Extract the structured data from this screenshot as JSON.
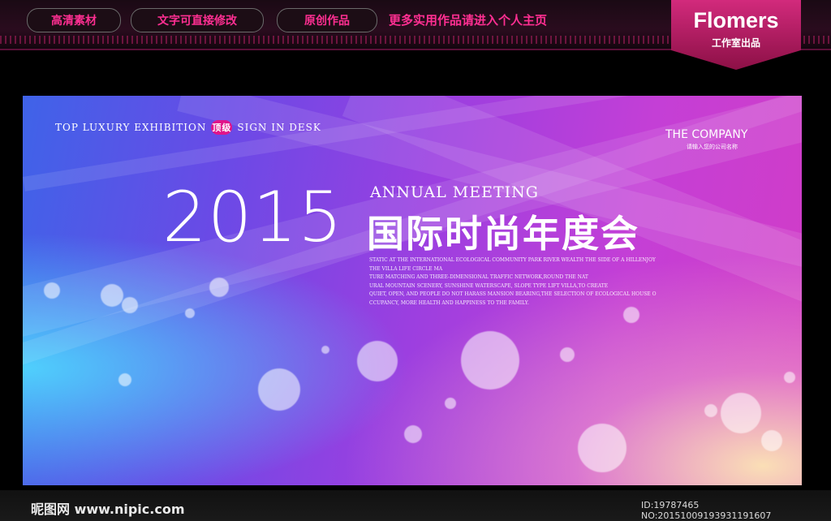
{
  "topbar": {
    "pills": [
      "高清素材",
      "文字可直接修改",
      "原创作品"
    ],
    "more": "更多实用作品请进入个人主页",
    "brand_name": "Flomers",
    "brand_sub": "工作室出品"
  },
  "poster": {
    "tagline_left": "TOP LUXURY EXHIBITION",
    "tagline_badge": "顶级",
    "tagline_right": "SIGN IN DESK",
    "company": "THE COMPANY",
    "company_sub": "请输入您的公司名称",
    "year": "2015",
    "annual": "ANNUAL MEETING",
    "title_cn": "国际时尚年度会",
    "desc_lines": [
      "STATIC AT THE INTERNATIONAL ECOLOGICAL COMMUNITY PARK RIVER WEALTH THE SIDE OF A HILLENJOY",
      "THE VILLA LIFE CIRCLE MA",
      "TURE MATCHING AND THREE-DIMENSIONAL TRAFFIC NETWORK,ROUND THE NAT",
      "URAL MOUNTAIN SCENERY, SUNSHINE WATERSCAPE, SLOPE TYPE LIFT VILLA,TO CREATE",
      "QUIET, OPEN, AND PEOPLE DO NOT HARASS MANSION BEARING,THE SELECTION OF ECOLOGICAL HOUSE O",
      "CCUPANCY, MORE HEALTH AND HAPPINESS TO THE FAMILY."
    ]
  },
  "footer": {
    "site": "昵图网 www.nipic.com",
    "id": "ID:19787465 NO:20151009193931191607"
  },
  "colors": {
    "accent_pink": "#ff2f92",
    "brand_bg": "#c0246e",
    "poster_left": "#3f63e8",
    "poster_right": "#d23cc6"
  }
}
